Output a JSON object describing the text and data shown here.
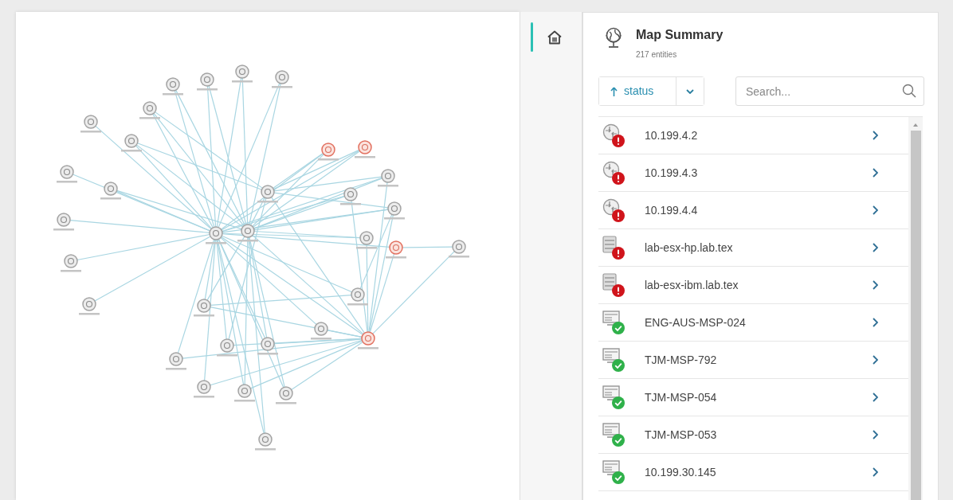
{
  "map": {
    "nodes": [
      {
        "alert": false
      },
      {
        "alert": false
      },
      {
        "alert": false
      },
      {
        "alert": false
      },
      {
        "alert": false
      },
      {
        "alert": false
      },
      {
        "alert": false
      },
      {
        "alert": false
      },
      {
        "alert": false
      },
      {
        "alert": false
      },
      {
        "alert": false
      },
      {
        "alert": false
      },
      {
        "alert": false
      },
      {
        "alert": false
      },
      {
        "alert": false
      },
      {
        "alert": true
      },
      {
        "alert": true
      },
      {
        "alert": false
      },
      {
        "alert": false
      },
      {
        "alert": false
      },
      {
        "alert": false
      },
      {
        "alert": true
      },
      {
        "alert": false
      },
      {
        "alert": false
      },
      {
        "alert": true
      },
      {
        "alert": false
      },
      {
        "alert": false
      },
      {
        "alert": false
      },
      {
        "alert": false
      },
      {
        "alert": false
      },
      {
        "alert": false
      },
      {
        "alert": false
      },
      {
        "alert": false
      },
      {
        "alert": false
      }
    ]
  },
  "nav": {
    "items": [
      {
        "kind": "home",
        "selected": true
      }
    ]
  },
  "summary": {
    "title": "Map Summary",
    "subtitle": "217 entities",
    "sort": {
      "label": "status",
      "ascending": true
    },
    "search": {
      "placeholder": "Search..."
    },
    "rows": [
      {
        "name": "10.199.4.2",
        "kind": "router",
        "alert": true
      },
      {
        "name": "10.199.4.3",
        "kind": "router",
        "alert": true
      },
      {
        "name": "10.199.4.4",
        "kind": "router",
        "alert": true
      },
      {
        "name": "lab-esx-hp.lab.tex",
        "kind": "server",
        "alert": true
      },
      {
        "name": "lab-esx-ibm.lab.tex",
        "kind": "server",
        "alert": true
      },
      {
        "name": "ENG-AUS-MSP-024",
        "kind": "desktop",
        "alert": false
      },
      {
        "name": "TJM-MSP-792",
        "kind": "desktop",
        "alert": false
      },
      {
        "name": "TJM-MSP-054",
        "kind": "desktop",
        "alert": false
      },
      {
        "name": "TJM-MSP-053",
        "kind": "desktop",
        "alert": false
      },
      {
        "name": "10.199.30.145",
        "kind": "desktop",
        "alert": false
      }
    ]
  }
}
